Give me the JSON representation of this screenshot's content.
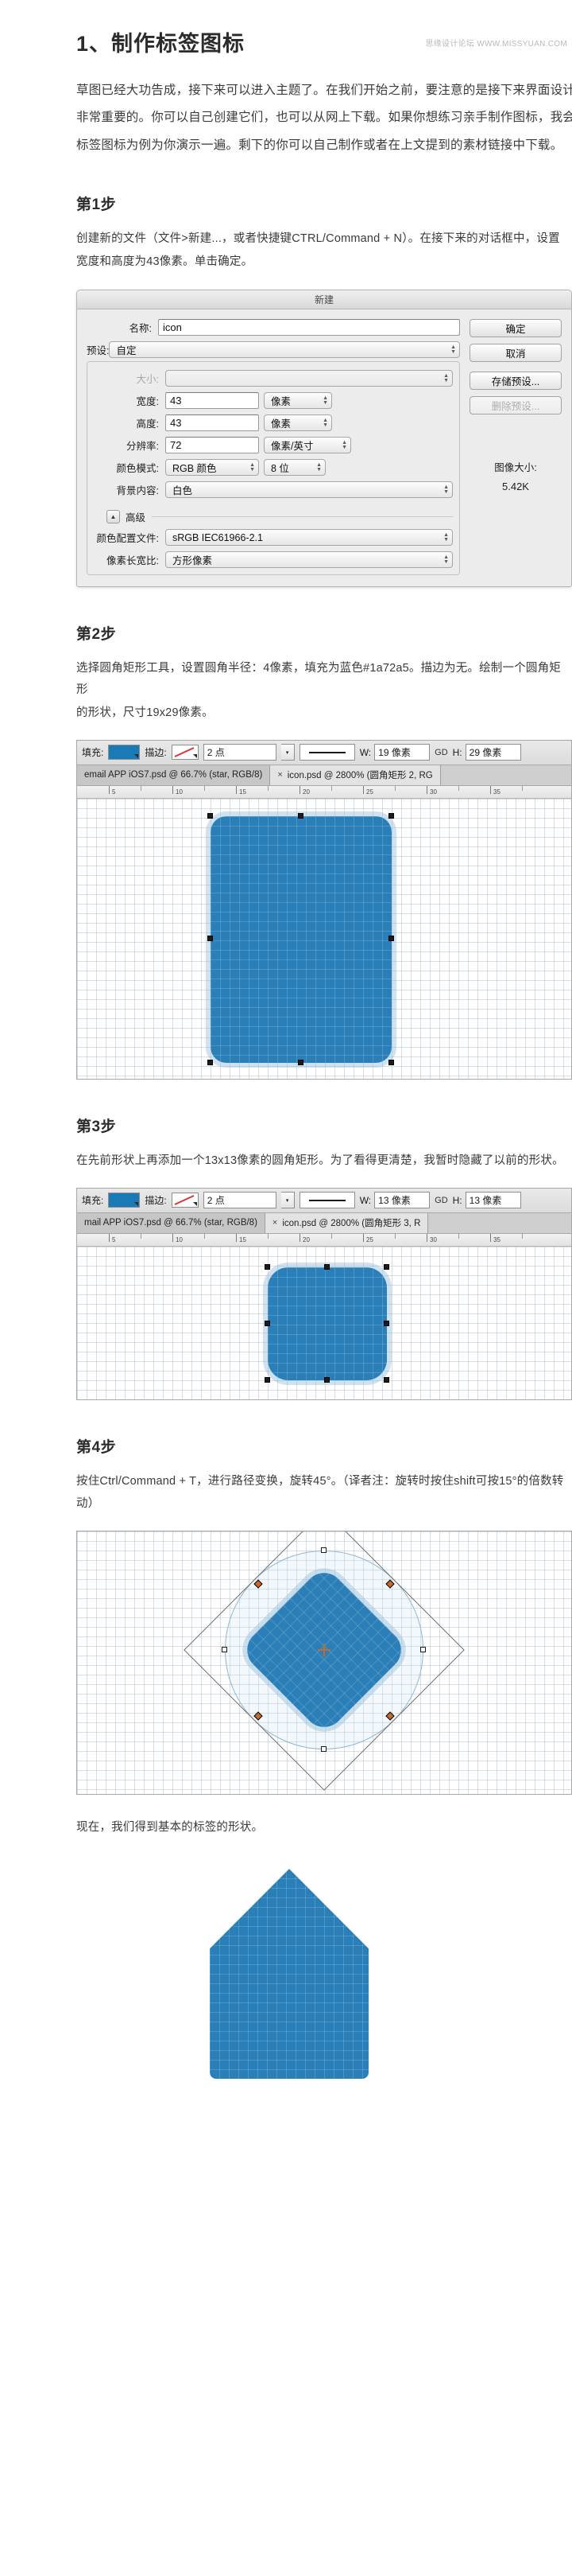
{
  "watermark": "思缘设计论坛 WWW.MISSYUAN.COM",
  "article": {
    "title": "1、制作标签图标",
    "intro_lines": [
      "草图已经大功告成，接下来可以进入主题了。在我们开始之前，要注意的是接下来界面设计中是",
      "非常重要的。你可以自己创建它们，也可以从网上下载。如果你想练习亲手制作图标，我会将以",
      "标签图标为例为你演示一遍。剩下的你可以自己制作或者在上文提到的素材链接中下载。"
    ]
  },
  "steps": [
    {
      "title": "第1步",
      "desc_lines": [
        "创建新的文件（文件>新建...，或者快捷键CTRL/Command + N）。在接下来的对话框中，设置",
        "宽度和高度为43像素。单击确定。"
      ]
    },
    {
      "title": "第2步",
      "desc_lines": [
        "选择圆角矩形工具，设置圆角半径：4像素，填充为蓝色#1a72a5。描边为无。绘制一个圆角矩形",
        "的形状，尺寸19x29像素。"
      ]
    },
    {
      "title": "第3步",
      "desc_lines": [
        "在先前形状上再添加一个13x13像素的圆角矩形。为了看得更清楚，我暂时隐藏了以前的形状。"
      ]
    },
    {
      "title": "第4步",
      "desc_lines": [
        "按住Ctrl/Command + T，进行路径变换，旋转45°。（译者注：旋转时按住shift可按15°的倍数转",
        "动）"
      ]
    }
  ],
  "closing_line": "现在，我们得到基本的标签的形状。",
  "dialog": {
    "title": "新建",
    "fields": {
      "name_label": "名称:",
      "name_value": "icon",
      "preset_label": "预设:",
      "preset_value": "自定",
      "size_label": "大小:",
      "size_value": "",
      "width_label": "宽度:",
      "width_value": "43",
      "width_unit": "像素",
      "height_label": "高度:",
      "height_value": "43",
      "height_unit": "像素",
      "resolution_label": "分辨率:",
      "resolution_value": "72",
      "resolution_unit": "像素/英寸",
      "colormode_label": "颜色模式:",
      "colormode_value": "RGB 颜色",
      "colordepth_value": "8 位",
      "background_label": "背景内容:",
      "background_value": "白色",
      "advanced_label": "高级",
      "colorprofile_label": "颜色配置文件:",
      "colorprofile_value": "sRGB IEC61966-2.1",
      "pixelaspect_label": "像素长宽比:",
      "pixelaspect_value": "方形像素"
    },
    "buttons": {
      "ok": "确定",
      "cancel": "取消",
      "save_preset": "存储预设...",
      "delete_preset": "删除预设..."
    },
    "image_size": {
      "label": "图像大小:",
      "value": "5.42K"
    }
  },
  "options_bar_step2": {
    "fill_label": "填充:",
    "fill_color": "#1a7ab5",
    "stroke_label": "描边:",
    "stroke_value": "无",
    "weight_value": "2 点",
    "w_label": "W:",
    "w_value": "19 像素",
    "link_label": "GD",
    "h_label": "H:",
    "h_value": "29 像素"
  },
  "options_bar_step3": {
    "fill_label": "填充:",
    "fill_color": "#1a7ab5",
    "stroke_label": "描边:",
    "stroke_value": "无",
    "weight_value": "2 点",
    "w_label": "W:",
    "w_value": "13 像素",
    "link_label": "GD",
    "h_label": "H:",
    "h_value": "13 像素"
  },
  "tabs_step2": [
    {
      "label": "email APP iOS7.psd @ 66.7% (star, RGB/8)",
      "active": false,
      "closable": false
    },
    {
      "label": "icon.psd @ 2800% (圆角矩形 2, RG",
      "active": true,
      "closable": true
    }
  ],
  "tabs_step3": [
    {
      "label": "mail APP iOS7.psd @ 66.7% (star, RGB/8)",
      "active": false,
      "closable": false
    },
    {
      "label": "icon.psd @ 2800% (圆角矩形 3, R",
      "active": true,
      "closable": true
    }
  ],
  "ruler_ticks_step2": [
    "5",
    "10",
    "15",
    "20",
    "25",
    "30",
    "35"
  ],
  "ruler_ticks_step3": [
    "5",
    "10",
    "15",
    "20",
    "25",
    "30",
    "35"
  ],
  "icons": {
    "close": "×",
    "stepper_up": "▲",
    "stepper_down": "▼",
    "disclosure": "▲",
    "dropdown": "▾",
    "link": "GD"
  }
}
